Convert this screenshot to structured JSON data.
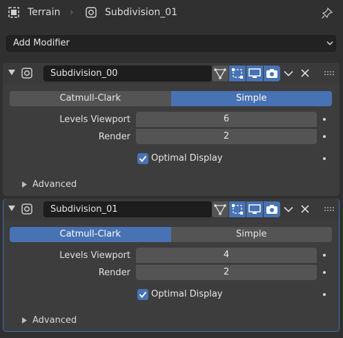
{
  "header": {
    "object_name": "Terrain",
    "separator": "›",
    "mesh_name": "Subdivision_01"
  },
  "add_modifier": {
    "label": "Add Modifier"
  },
  "modifiers": [
    {
      "name": "Subdivision_00",
      "mode_options": [
        "Catmull-Clark",
        "Simple"
      ],
      "selected_mode": "Simple",
      "levels_viewport_label": "Levels Viewport",
      "levels_viewport": "6",
      "render_label": "Render",
      "render": "2",
      "optimal_display_label": "Optimal Display",
      "optimal_display": true,
      "advanced_label": "Advanced"
    },
    {
      "name": "Subdivision_01",
      "mode_options": [
        "Catmull-Clark",
        "Simple"
      ],
      "selected_mode": "Catmull-Clark",
      "levels_viewport_label": "Levels Viewport",
      "levels_viewport": "4",
      "render_label": "Render",
      "render": "2",
      "optimal_display_label": "Optimal Display",
      "optimal_display": true,
      "advanced_label": "Advanced"
    }
  ],
  "colors": {
    "accent": "#4772b3",
    "background": "#303030",
    "panel": "#3d3d3d"
  }
}
